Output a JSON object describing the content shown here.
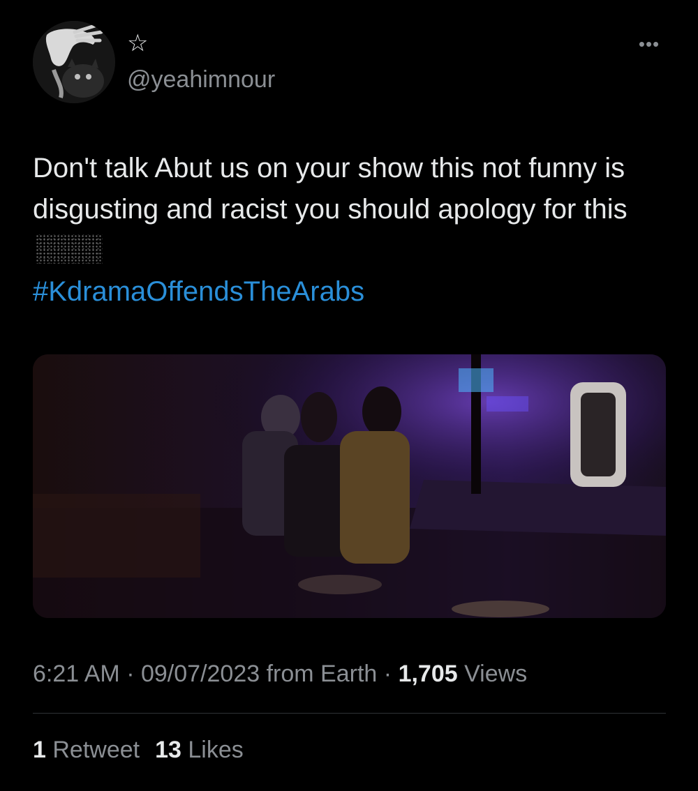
{
  "tweet": {
    "display_name_icon": "☆",
    "handle": "@yeahimnour",
    "more_icon": "•••",
    "text_main": "Don't talk Abut us on your show this not funny is disgusting and racist you should apology for this",
    "hashtag": "#KdramaOffendsTheArabs",
    "time": "6:21 AM",
    "separator": "·",
    "date": "09/07/2023",
    "source": "from Earth",
    "views_count": "1,705",
    "views_label": "Views",
    "retweets_count": "1",
    "retweets_label": "Retweet",
    "likes_count": "13",
    "likes_label": "Likes"
  },
  "colors": {
    "background": "#000000",
    "text": "#e7e9ea",
    "secondary": "#8b8f94",
    "link": "#2a8fd9",
    "divider": "#2f3336"
  },
  "icons": {
    "avatar": "profile-photo-hand-over-cat",
    "more": "more-options-icon",
    "censor": "pixelated-emoji-censor"
  }
}
